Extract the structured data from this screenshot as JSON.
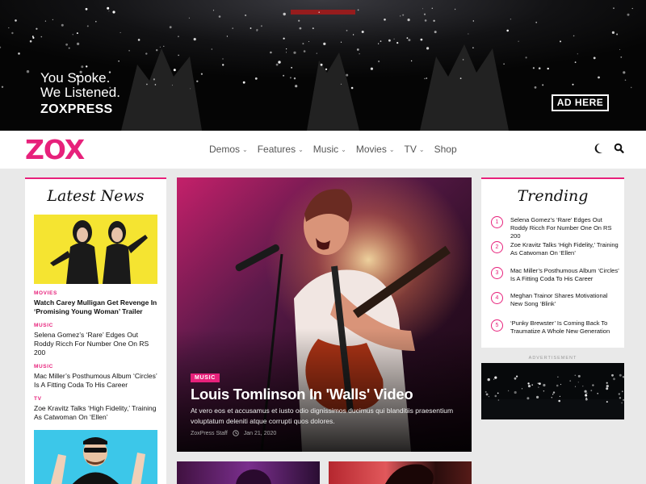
{
  "banner": {
    "line1": "You Spoke.",
    "line2": "We Listened.",
    "brand": "ZOXPRESS",
    "ad_button": "AD HERE"
  },
  "nav": {
    "logo": "ZOX",
    "items": [
      {
        "label": "Demos",
        "dropdown": true
      },
      {
        "label": "Features",
        "dropdown": true
      },
      {
        "label": "Music",
        "dropdown": true
      },
      {
        "label": "Movies",
        "dropdown": true
      },
      {
        "label": "TV",
        "dropdown": true
      },
      {
        "label": "Shop",
        "dropdown": false
      }
    ],
    "icons": [
      "moon-icon",
      "search-icon"
    ]
  },
  "latest": {
    "title": "Latest News",
    "items": [
      {
        "category": "MOVIES",
        "headline": "Watch Carey Mulligan Get Revenge In ‘Promising Young Woman’ Trailer"
      },
      {
        "category": "MUSIC",
        "headline": "Selena Gomez’s ‘Rare’ Edges Out Roddy Ricch For Number One On RS 200"
      },
      {
        "category": "MUSIC",
        "headline": "Mac Miller’s Posthumous Album ‘Circles’ Is A Fitting Coda To His Career"
      },
      {
        "category": "TV",
        "headline": "Zoe Kravitz Talks ‘High Fidelity,’ Training As Catwoman On ‘Ellen’"
      }
    ]
  },
  "hero": {
    "category": "MUSIC",
    "title": "Louis Tomlinson In 'Walls' Video",
    "excerpt": "At vero eos et accusamus et iusto odio dignissimos ducimus qui blanditiis praesentium voluptatum deleniti atque corrupti quos dolores.",
    "author": "ZoxPress Staff",
    "date": "Jan 21, 2020"
  },
  "trending": {
    "title": "Trending",
    "items": [
      {
        "num": "1",
        "headline": "Selena Gomez’s ‘Rare’ Edges Out Roddy Ricch For Number One On RS 200"
      },
      {
        "num": "2",
        "headline": "Zoe Kravitz Talks ‘High Fidelity,’ Training As Catwoman On ‘Ellen’"
      },
      {
        "num": "3",
        "headline": "Mac Miller’s Posthumous Album ‘Circles’ Is A Fitting Coda To His Career"
      },
      {
        "num": "4",
        "headline": "Meghan Trainor Shares Motivational New Song ‘Blink’"
      },
      {
        "num": "5",
        "headline": "‘Punky Brewster’ Is Coming Back To Traumatize A Whole New Generation"
      }
    ]
  },
  "sidebar_ad": {
    "label": "ADVERTISEMENT"
  },
  "colors": {
    "accent": "#e7217b",
    "dark": "#060606",
    "background": "#e9e9e9"
  }
}
